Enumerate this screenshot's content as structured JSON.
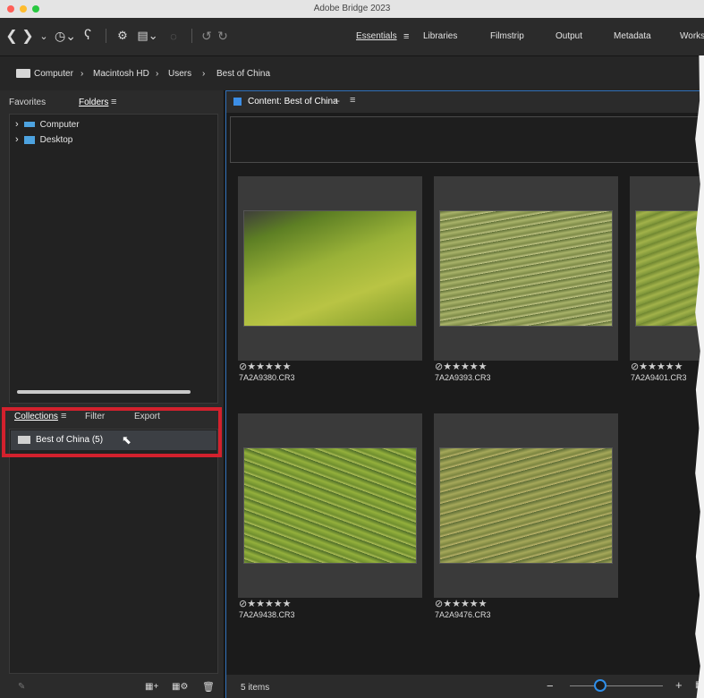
{
  "app": {
    "title": "Adobe Bridge 2023"
  },
  "workspaces": [
    "Essentials",
    "Libraries",
    "Filmstrip",
    "Output",
    "Metadata",
    "Works"
  ],
  "breadcrumb": [
    "Computer",
    "Macintosh HD",
    "Users",
    "Best of China"
  ],
  "left_tabs": {
    "favorites": "Favorites",
    "folders": "Folders"
  },
  "folders": [
    "Computer",
    "Desktop"
  ],
  "collections_tabs": {
    "collections": "Collections",
    "filter": "Filter",
    "export": "Export"
  },
  "collection_item": "Best of China (5)",
  "content_title": "Content: Best of China",
  "thumbnails": [
    {
      "filename": "7A2A9380.CR3",
      "stars": "⊘★★★★★",
      "bg": "#6c8f2a"
    },
    {
      "filename": "7A2A9393.CR3",
      "stars": "⊘★★★★★",
      "bg": "#8c9a52"
    },
    {
      "filename": "7A2A9401.CR3",
      "stars": "⊘★★★★★",
      "bg": "#7d943b"
    },
    {
      "filename": "7A2A9438.CR3",
      "stars": "⊘★★★★★",
      "bg": "#6f8a3d"
    },
    {
      "filename": "7A2A9476.CR3",
      "stars": "⊘★★★★★",
      "bg": "#8a9348"
    }
  ],
  "status": {
    "items": "5 items"
  },
  "zoom": {
    "level": 0.2
  }
}
